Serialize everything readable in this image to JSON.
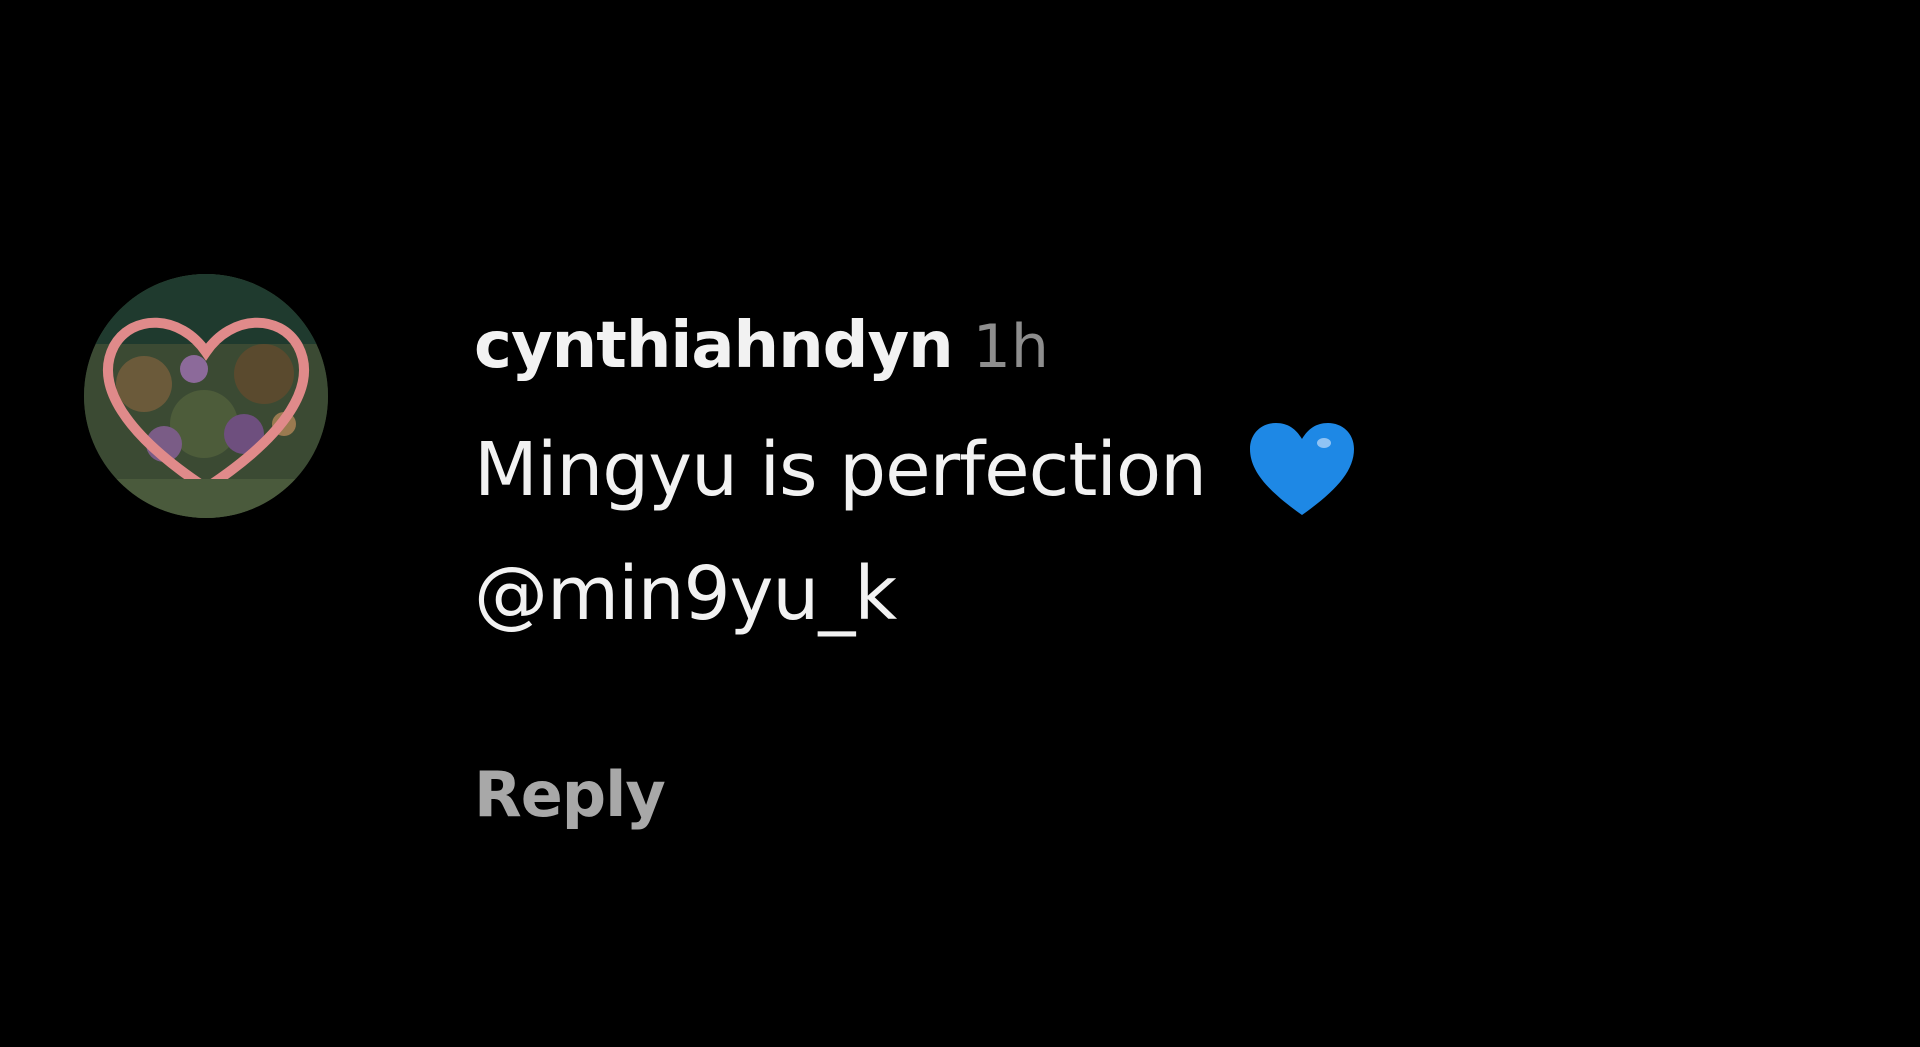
{
  "comment": {
    "username": "cynthiahndyn",
    "timestamp": "1h",
    "text": "Mingyu is perfection",
    "emoji": "blue-heart-icon",
    "mention": "@min9yu_k",
    "reply_label": "Reply"
  },
  "colors": {
    "background": "#000000",
    "text": "#f2f2f2",
    "muted": "#8e8e8e",
    "heart": "#1e88e5"
  }
}
